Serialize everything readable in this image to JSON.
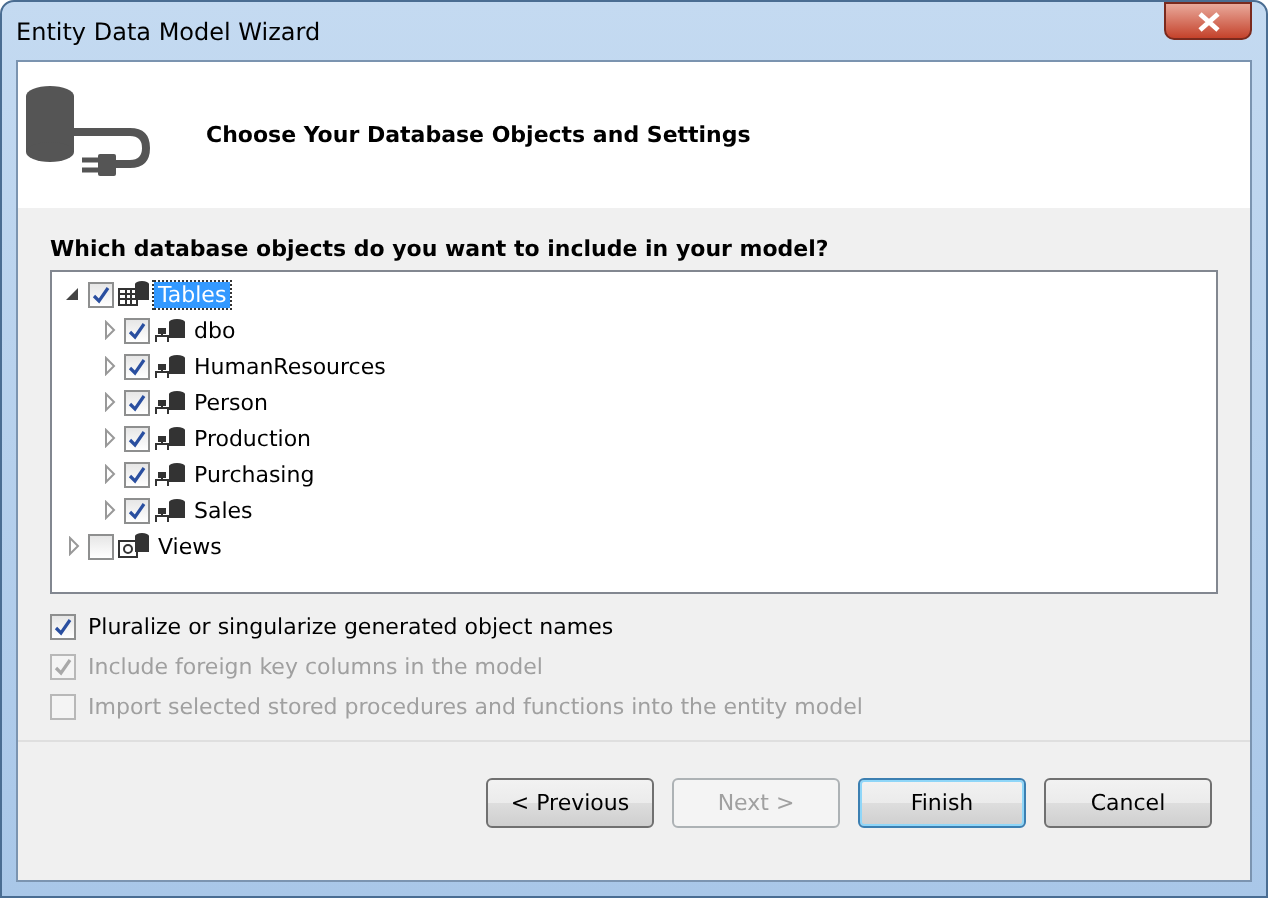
{
  "window": {
    "title": "Entity Data Model Wizard"
  },
  "header": {
    "title": "Choose Your Database Objects and Settings"
  },
  "question": "Which database objects do you want to include in your model?",
  "tree": [
    {
      "label": "Tables",
      "kind": "tables",
      "checked": true,
      "expanded": true,
      "selected": true,
      "children": [
        {
          "label": "dbo",
          "kind": "schema",
          "checked": true,
          "expanded": false,
          "selected": false
        },
        {
          "label": "HumanResources",
          "kind": "schema",
          "checked": true,
          "expanded": false,
          "selected": false
        },
        {
          "label": "Person",
          "kind": "schema",
          "checked": true,
          "expanded": false,
          "selected": false
        },
        {
          "label": "Production",
          "kind": "schema",
          "checked": true,
          "expanded": false,
          "selected": false
        },
        {
          "label": "Purchasing",
          "kind": "schema",
          "checked": true,
          "expanded": false,
          "selected": false
        },
        {
          "label": "Sales",
          "kind": "schema",
          "checked": true,
          "expanded": false,
          "selected": false
        }
      ]
    },
    {
      "label": "Views",
      "kind": "views",
      "checked": false,
      "expanded": false,
      "selected": false
    }
  ],
  "options": [
    {
      "label": "Pluralize or singularize generated object names",
      "checked": true,
      "disabled": false
    },
    {
      "label": "Include foreign key columns in the model",
      "checked": true,
      "disabled": true
    },
    {
      "label": "Import selected stored procedures and functions into the entity model",
      "checked": false,
      "disabled": true
    }
  ],
  "buttons": [
    {
      "label": "< Previous",
      "disabled": false,
      "default": false
    },
    {
      "label": "Next >",
      "disabled": true,
      "default": false
    },
    {
      "label": "Finish",
      "disabled": false,
      "default": true
    },
    {
      "label": "Cancel",
      "disabled": false,
      "default": false
    }
  ]
}
